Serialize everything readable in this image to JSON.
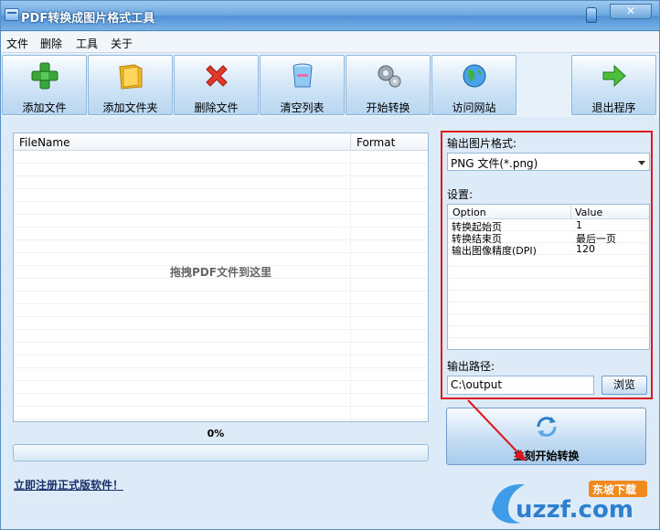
{
  "window": {
    "title": "PDF转换成图片格式工具",
    "close_label": "✕"
  },
  "menu": [
    "文件",
    "删除",
    "工具",
    "关于"
  ],
  "toolbar": [
    {
      "label": "添加文件",
      "icon": "add-file-icon"
    },
    {
      "label": "添加文件夹",
      "icon": "add-folder-icon"
    },
    {
      "label": "删除文件",
      "icon": "delete-file-icon"
    },
    {
      "label": "清空列表",
      "icon": "clear-list-icon"
    },
    {
      "label": "开始转换",
      "icon": "start-convert-icon"
    },
    {
      "label": "访问网站",
      "icon": "visit-website-icon"
    },
    {
      "label": "退出程序",
      "icon": "exit-program-icon"
    }
  ],
  "file_list": {
    "columns": [
      "FileName",
      "Format"
    ],
    "drop_hint": "拖拽PDF文件到这里"
  },
  "progress": {
    "text": "0%",
    "value": 0
  },
  "register_link": "立即注册正式版软件！",
  "settings": {
    "format_label": "输出图片格式:",
    "format_value": "PNG 文件(*.png)",
    "settings_label": "设置:",
    "columns": [
      "Option",
      "Value"
    ],
    "options": [
      {
        "option": "转换起始页",
        "value": "1"
      },
      {
        "option": "转换结束页",
        "value": "最后一页"
      },
      {
        "option": "输出图像精度(DPI)",
        "value": "120"
      }
    ],
    "path_label": "输出路径:",
    "path_value": "C:\\output",
    "browse_label": "浏览"
  },
  "start_button": {
    "label": "立刻开始转换"
  },
  "watermark": {
    "brand": "uzzf.com",
    "tag": "东坡下载"
  },
  "colors": {
    "annotation_red": "#e0161e",
    "title_blue": "#4f92d6"
  }
}
